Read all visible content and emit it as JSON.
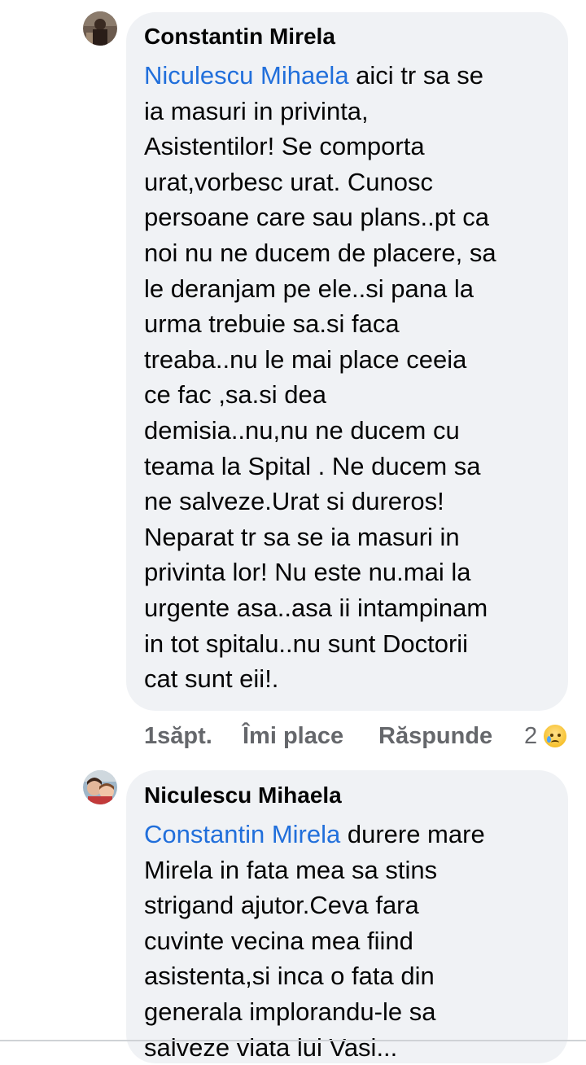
{
  "comments": [
    {
      "author": "Constantin Mirela",
      "mention": "Niculescu Mihaela",
      "first_line_rest": " aici tr sa se",
      "lines": [
        "ia masuri in privinta,",
        "Asistentilor! Se comporta",
        "urat,vorbesc urat. Cunosc",
        "persoane care sau plans..pt ca",
        "noi nu ne ducem de placere, sa",
        "le deranjam pe ele..si pana la",
        "urma trebuie sa.si faca",
        "treaba..nu le mai place ceeia",
        "ce fac ,sa.si dea",
        "demisia..nu,nu ne ducem cu",
        "teama la Spital . Ne ducem sa",
        "ne salveze.Urat si dureros!",
        "Neparat tr sa se ia masuri in",
        "privinta lor! Nu este nu.mai la",
        "urgente asa..asa ii intampinam",
        "in tot spitalu..nu sunt Doctorii",
        "cat sunt eii!."
      ],
      "time": "1săpt.",
      "like_label": "Îmi place",
      "reply_label": "Răspunde",
      "reaction_count": "2",
      "reaction_icon": "sad-face-icon"
    },
    {
      "author": "Niculescu Mihaela",
      "mention": "Constantin Mirela",
      "first_line_rest": " durere mare",
      "lines": [
        "Mirela  in fata mea sa stins",
        "strigand ajutor.Ceva fara",
        "cuvinte vecina mea fiind",
        "asistenta,si inca o fata din",
        "generala implorandu-le sa",
        "salveze viata lui Vasi..."
      ]
    }
  ],
  "colors": {
    "mention": "#216fdb",
    "bubble": "#f0f2f5",
    "meta": "#65676b"
  }
}
